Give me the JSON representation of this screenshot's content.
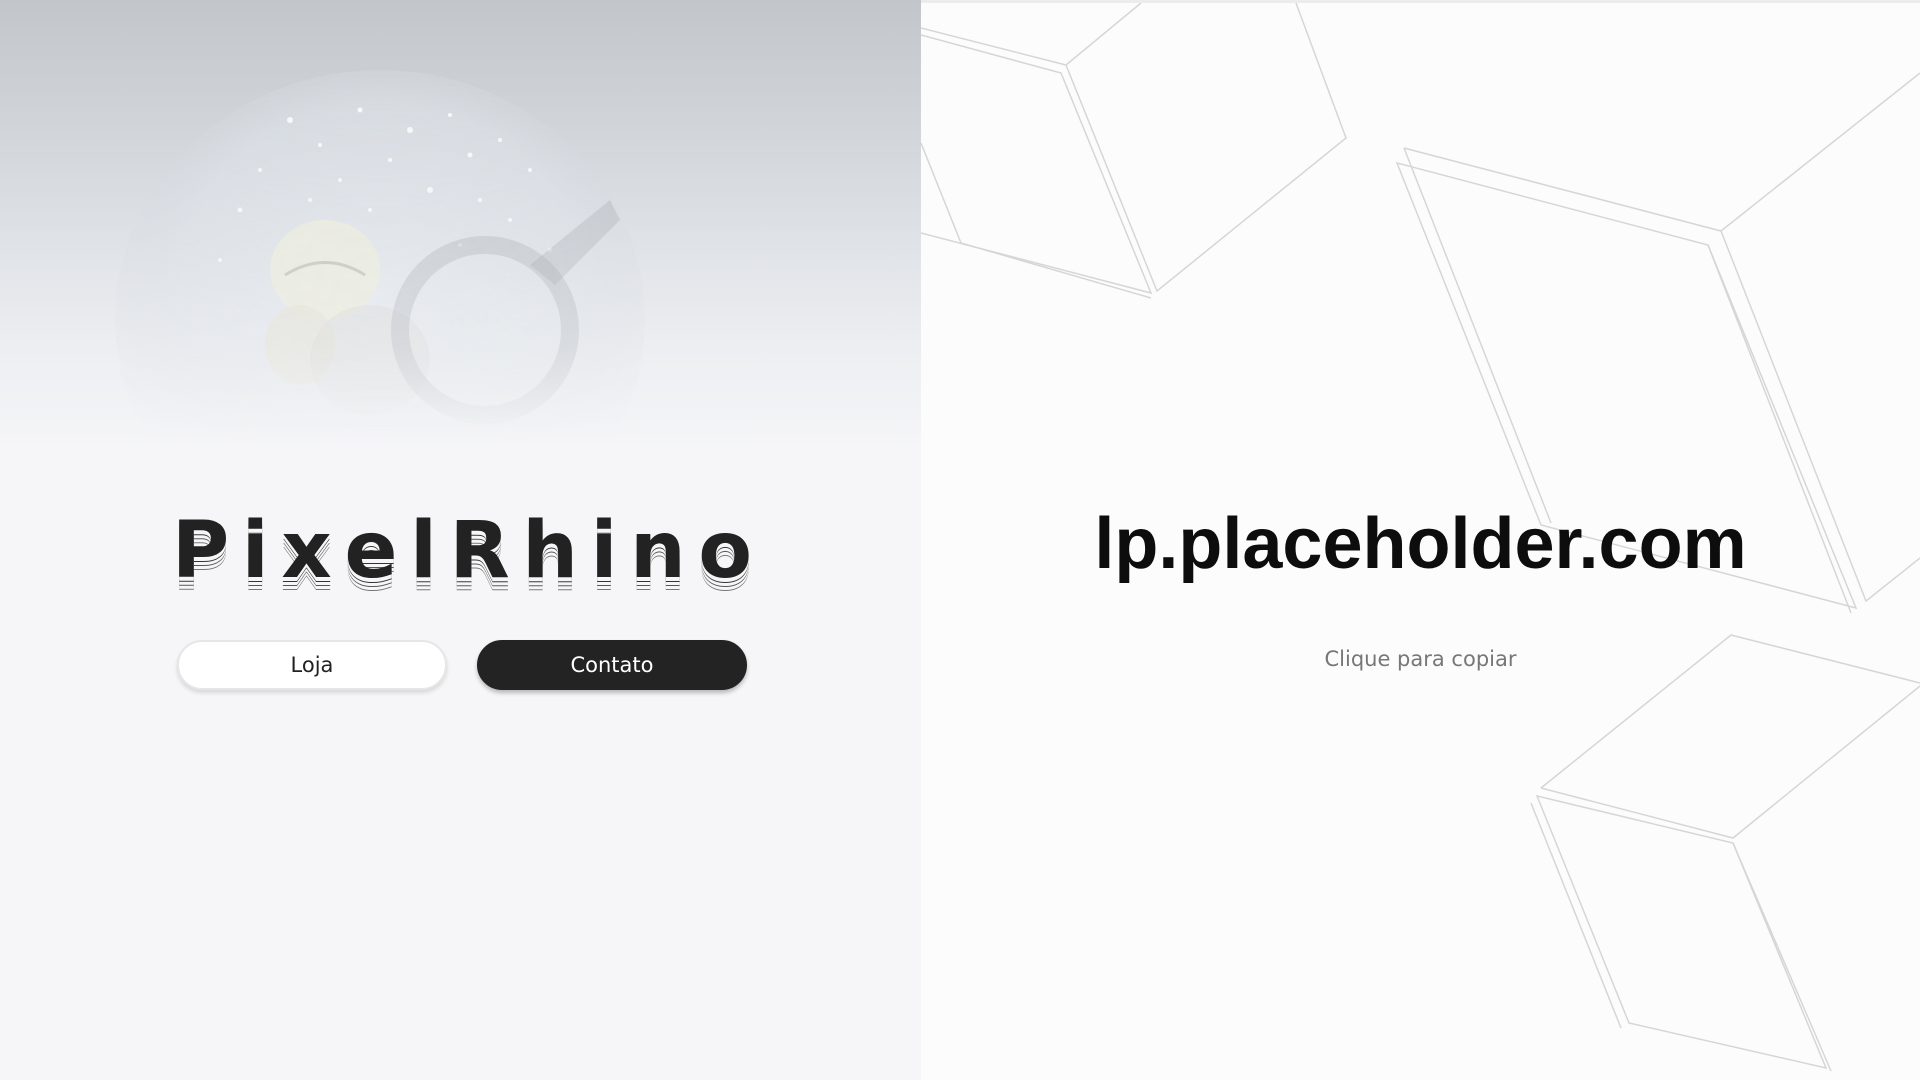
{
  "left_panel": {
    "brand_letters": [
      "P",
      "i",
      "x",
      "e",
      "l",
      "R",
      "h",
      "i",
      "n",
      "o"
    ],
    "buttons": {
      "store_label": "Loja",
      "contact_label": "Contato"
    }
  },
  "right_panel": {
    "domain": "lp.placeholder.com",
    "copy_hint": "Clique para copiar"
  },
  "colors": {
    "dark_button": "#232323",
    "light_button": "#ffffff",
    "text_dark": "#0d0d0d",
    "text_muted": "#777777"
  }
}
